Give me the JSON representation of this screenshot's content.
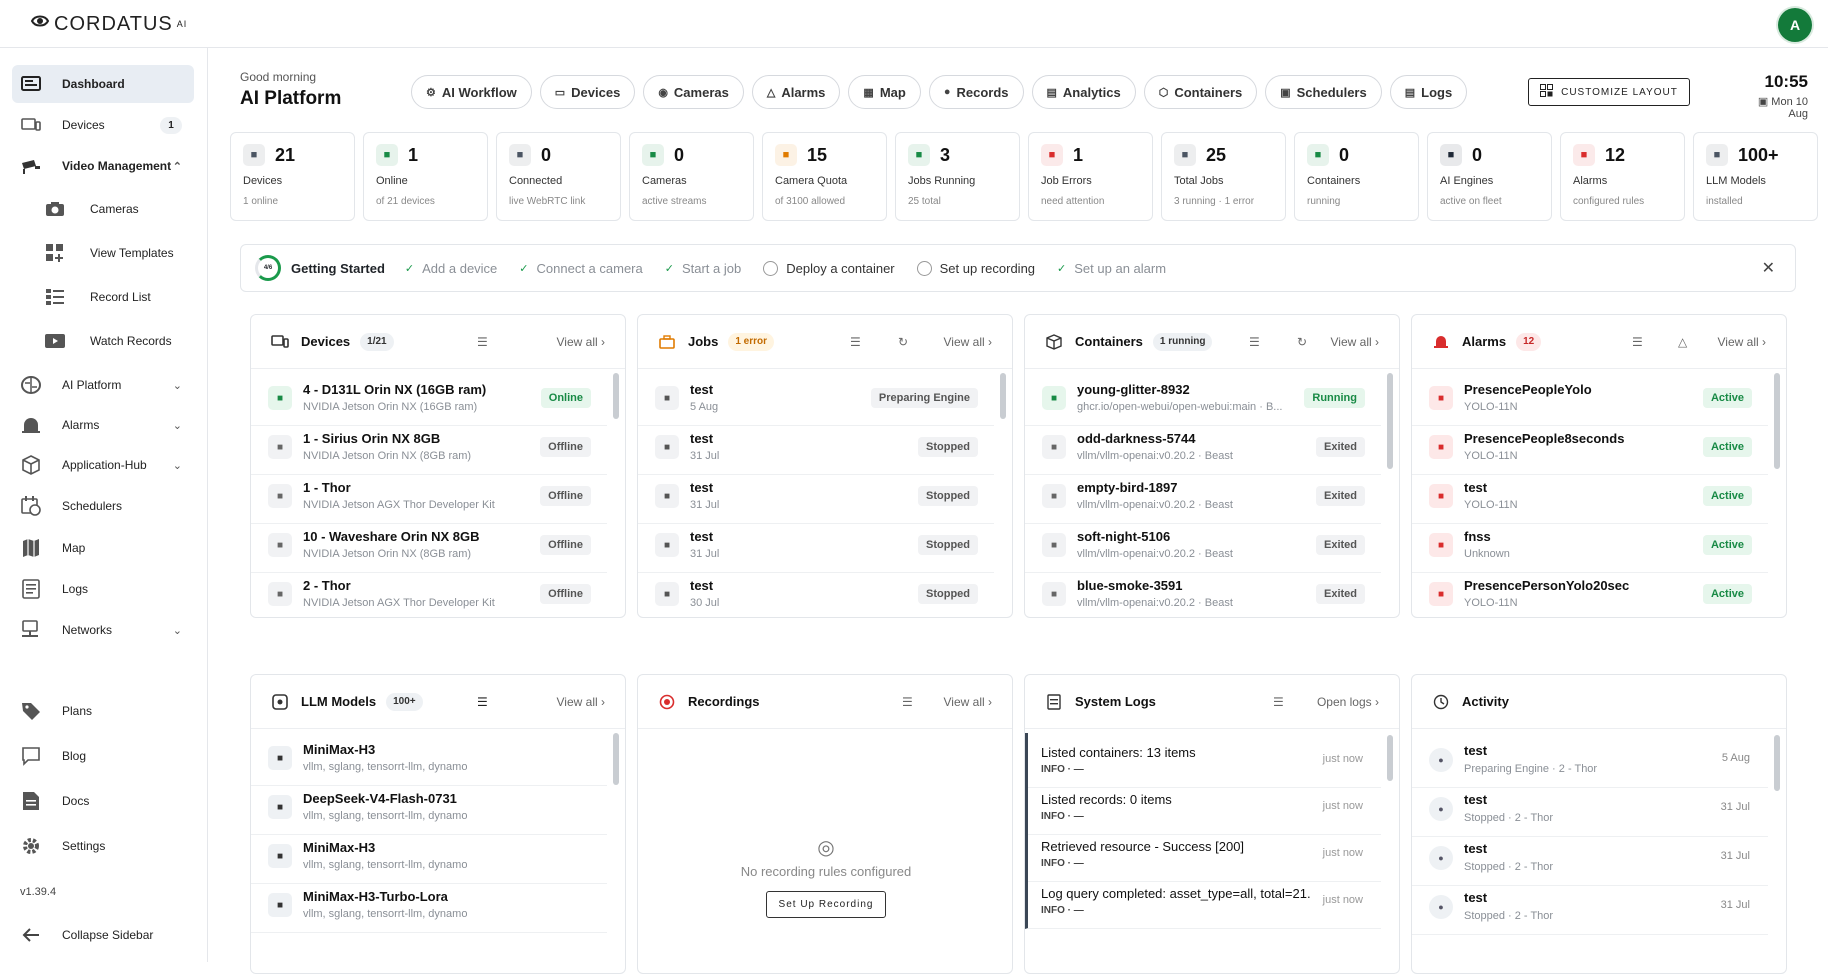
{
  "brand": {
    "name": "CORDATUS",
    "suffix": "AI"
  },
  "user": {
    "initial": "A"
  },
  "sidebar": {
    "items": [
      {
        "label": "Dashboard"
      },
      {
        "label": "Devices",
        "badge": "1"
      },
      {
        "label": "Video Management"
      },
      {
        "label": "Cameras"
      },
      {
        "label": "View Templates"
      },
      {
        "label": "Record List"
      },
      {
        "label": "Watch Records"
      },
      {
        "label": "AI Platform"
      },
      {
        "label": "Alarms"
      },
      {
        "label": "Application-Hub"
      },
      {
        "label": "Schedulers"
      },
      {
        "label": "Map"
      },
      {
        "label": "Logs"
      },
      {
        "label": "Networks"
      },
      {
        "label": "Plans"
      },
      {
        "label": "Blog"
      },
      {
        "label": "Docs"
      },
      {
        "label": "Settings"
      },
      {
        "label": "Collapse Sidebar"
      }
    ],
    "version": "v1.39.4"
  },
  "header": {
    "greeting": "Good morning",
    "title": "AI Platform",
    "nav": [
      "AI Workflow",
      "Devices",
      "Cameras",
      "Alarms",
      "Map",
      "Records",
      "Analytics",
      "Containers",
      "Schedulers",
      "Logs"
    ],
    "customize": "CUSTOMIZE LAYOUT",
    "time": "10:55",
    "date": "Mon 10 Aug"
  },
  "stats": [
    {
      "value": "21",
      "label": "Devices",
      "sub": "1 online",
      "icon": "device-icon",
      "color": "#4b5563"
    },
    {
      "value": "1",
      "label": "Online",
      "sub": "of 21 devices",
      "icon": "wifi-icon",
      "color": "#188a45"
    },
    {
      "value": "0",
      "label": "Connected",
      "sub": "live WebRTC link",
      "icon": "link-icon",
      "color": "#4b5563"
    },
    {
      "value": "0",
      "label": "Cameras",
      "sub": "active streams",
      "icon": "camera-icon",
      "color": "#188a45"
    },
    {
      "value": "15",
      "label": "Camera Quota",
      "sub": "of 3100 allowed",
      "icon": "quota-icon",
      "color": "#e07b00"
    },
    {
      "value": "3",
      "label": "Jobs Running",
      "sub": "25 total",
      "icon": "briefcase-icon",
      "color": "#188a45"
    },
    {
      "value": "1",
      "label": "Job Errors",
      "sub": "need attention",
      "icon": "error-icon",
      "color": "#d92d2d"
    },
    {
      "value": "25",
      "label": "Total Jobs",
      "sub": "3 running · 1 error",
      "icon": "jobs-icon",
      "color": "#4b5563"
    },
    {
      "value": "0",
      "label": "Containers",
      "sub": "running",
      "icon": "cube-icon",
      "color": "#188a45"
    },
    {
      "value": "0",
      "label": "AI Engines",
      "sub": "active on fleet",
      "icon": "chip-icon",
      "color": "#1f2937"
    },
    {
      "value": "12",
      "label": "Alarms",
      "sub": "configured rules",
      "icon": "bell-icon",
      "color": "#d92d2d"
    },
    {
      "value": "100+",
      "label": "LLM Models",
      "sub": "installed",
      "icon": "llm-icon",
      "color": "#4b5563"
    }
  ],
  "getting_started": {
    "progress": "4/6",
    "title": "Getting Started",
    "steps": [
      {
        "label": "Add a device",
        "done": true
      },
      {
        "label": "Connect a camera",
        "done": true
      },
      {
        "label": "Start a job",
        "done": true
      },
      {
        "label": "Deploy a container",
        "done": false
      },
      {
        "label": "Set up recording",
        "done": false
      },
      {
        "label": "Set up an alarm",
        "done": true
      }
    ]
  },
  "cards": {
    "devices": {
      "title": "Devices",
      "badge": "1/21",
      "view_all": "View all",
      "rows": [
        {
          "title": "4 - D131L Orin NX (16GB ram)",
          "sub": "NVIDIA Jetson Orin NX (16GB ram)",
          "status": "Online"
        },
        {
          "title": "1 - Sirius Orin NX 8GB",
          "sub": "NVIDIA Jetson Orin NX (8GB ram)",
          "status": "Offline"
        },
        {
          "title": "1 - Thor",
          "sub": "NVIDIA Jetson AGX Thor Developer Kit",
          "status": "Offline"
        },
        {
          "title": "10 - Waveshare Orin NX 8GB",
          "sub": "NVIDIA Jetson Orin NX (8GB ram)",
          "status": "Offline"
        },
        {
          "title": "2 - Thor",
          "sub": "NVIDIA Jetson AGX Thor Developer Kit",
          "status": "Offline"
        }
      ]
    },
    "jobs": {
      "title": "Jobs",
      "badge": "1 error",
      "view_all": "View all",
      "rows": [
        {
          "title": "test",
          "sub": "5 Aug",
          "status": "Preparing Engine"
        },
        {
          "title": "test",
          "sub": "31 Jul",
          "status": "Stopped"
        },
        {
          "title": "test",
          "sub": "31 Jul",
          "status": "Stopped"
        },
        {
          "title": "test",
          "sub": "31 Jul",
          "status": "Stopped"
        },
        {
          "title": "test",
          "sub": "30 Jul",
          "status": "Stopped"
        }
      ]
    },
    "containers": {
      "title": "Containers",
      "badge": "1 running",
      "view_all": "View all",
      "rows": [
        {
          "title": "young-glitter-8932",
          "sub": "ghcr.io/open-webui/open-webui:main · B...",
          "status": "Running"
        },
        {
          "title": "odd-darkness-5744",
          "sub": "vllm/vllm-openai:v0.20.2 · Beast",
          "status": "Exited"
        },
        {
          "title": "empty-bird-1897",
          "sub": "vllm/vllm-openai:v0.20.2 · Beast",
          "status": "Exited"
        },
        {
          "title": "soft-night-5106",
          "sub": "vllm/vllm-openai:v0.20.2 · Beast",
          "status": "Exited"
        },
        {
          "title": "blue-smoke-3591",
          "sub": "vllm/vllm-openai:v0.20.2 · Beast",
          "status": "Exited"
        }
      ]
    },
    "alarms": {
      "title": "Alarms",
      "badge": "12",
      "view_all": "View all",
      "rows": [
        {
          "title": "PresencePeopleYolo",
          "sub": "YOLO-11N",
          "status": "Active"
        },
        {
          "title": "PresencePeople8seconds",
          "sub": "YOLO-11N",
          "status": "Active"
        },
        {
          "title": "test",
          "sub": "YOLO-11N",
          "status": "Active"
        },
        {
          "title": "fnss",
          "sub": "Unknown",
          "status": "Active"
        },
        {
          "title": "PresencePersonYolo20sec",
          "sub": "YOLO-11N",
          "status": "Active"
        }
      ]
    },
    "llm": {
      "title": "LLM Models",
      "badge": "100+",
      "view_all": "View all",
      "rows": [
        {
          "title": "MiniMax-H3",
          "sub": "vllm, sglang, tensorrt-llm, dynamo"
        },
        {
          "title": "DeepSeek-V4-Flash-0731",
          "sub": "vllm, sglang, tensorrt-llm, dynamo"
        },
        {
          "title": "MiniMax-H3",
          "sub": "vllm, sglang, tensorrt-llm, dynamo"
        },
        {
          "title": "MiniMax-H3-Turbo-Lora",
          "sub": "vllm, sglang, tensorrt-llm, dynamo"
        }
      ]
    },
    "recordings": {
      "title": "Recordings",
      "view_all": "View all",
      "empty_text": "No recording rules configured",
      "button": "Set Up Recording"
    },
    "logs": {
      "title": "System Logs",
      "view_all": "Open logs",
      "rows": [
        {
          "text": "Listed containers: 13 items",
          "level": "INFO · —",
          "when": "just now"
        },
        {
          "text": "Listed records: 0 items",
          "level": "INFO · —",
          "when": "just now"
        },
        {
          "text": "Retrieved resource - Success [200]",
          "level": "INFO · —",
          "when": "just now"
        },
        {
          "text": "Log query completed: asset_type=all, total=21...",
          "level": "INFO · —",
          "when": "just now"
        }
      ]
    },
    "activity": {
      "title": "Activity",
      "rows": [
        {
          "title": "test",
          "sub": "Preparing Engine · 2 - Thor",
          "date": "5 Aug"
        },
        {
          "title": "test",
          "sub": "Stopped · 2 - Thor",
          "date": "31 Jul"
        },
        {
          "title": "test",
          "sub": "Stopped · 2 - Thor",
          "date": "31 Jul"
        },
        {
          "title": "test",
          "sub": "Stopped · 2 - Thor",
          "date": "31 Jul"
        }
      ]
    }
  }
}
